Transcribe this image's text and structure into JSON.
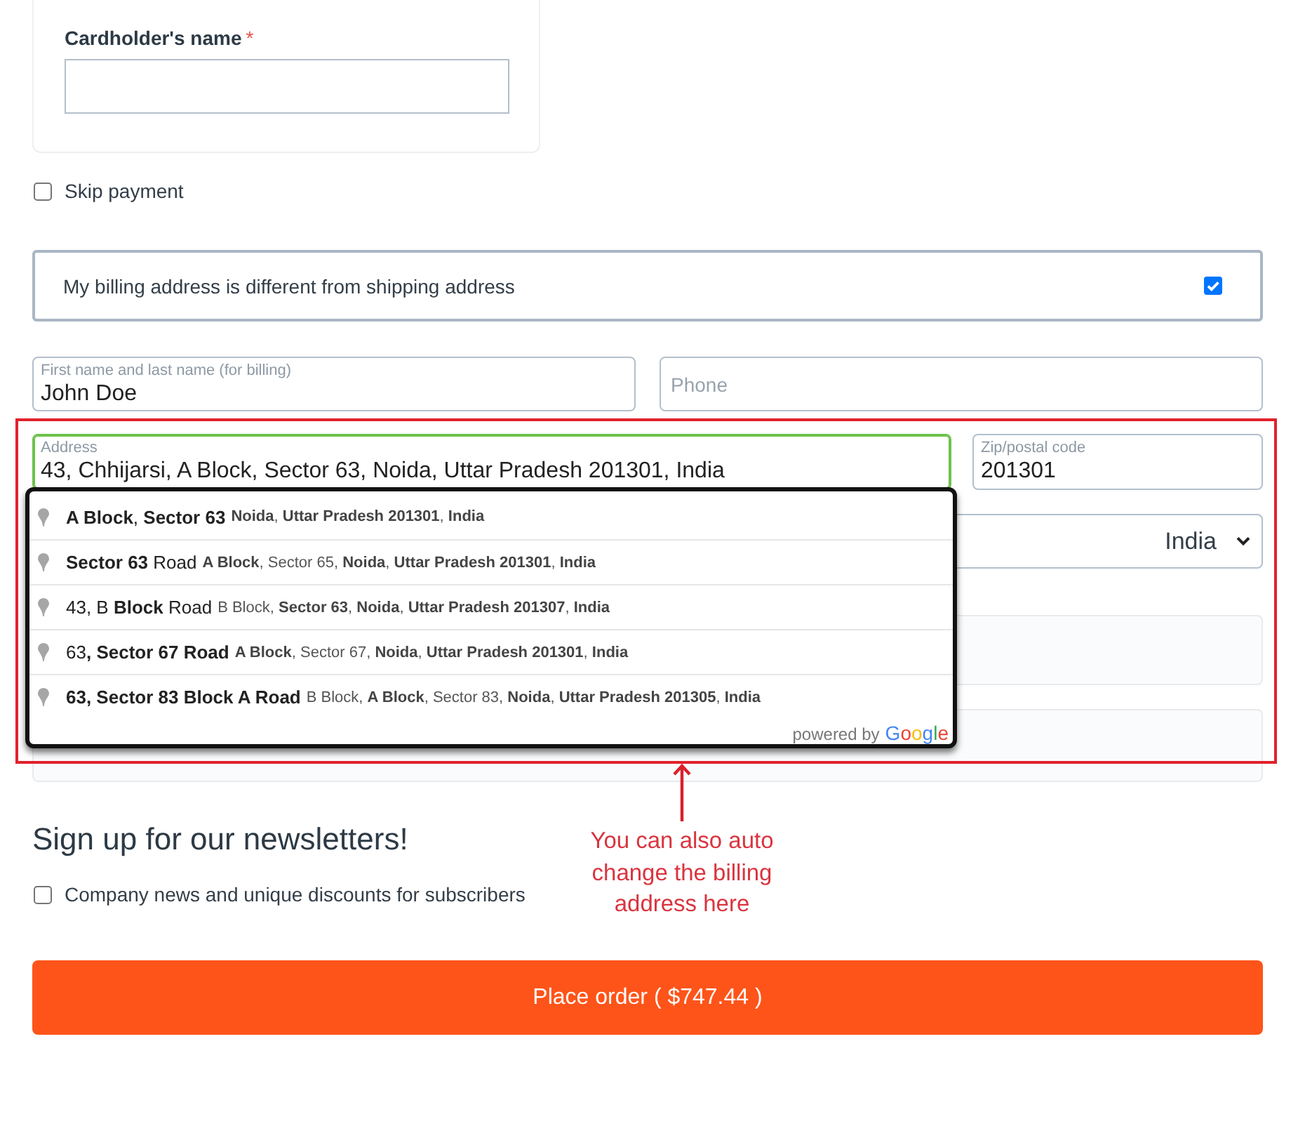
{
  "payment_card": {
    "label": "Cardholder's name",
    "required_mark": "*"
  },
  "skip_payment": {
    "label": "Skip payment",
    "checked": false
  },
  "billing_toggle": {
    "label": "My billing address is different from shipping address",
    "checked": true
  },
  "billing_fields": [
    {
      "kind": "text",
      "label": "First name and last name (for billing)",
      "value": "John Doe",
      "focused": false
    },
    {
      "kind": "text",
      "placeholder": "Phone",
      "focused": false
    },
    {
      "kind": "text",
      "label": "Address",
      "value": "43, Chhijarsi, A Block, Sector 63, Noida, Uttar Pradesh 201301, India",
      "focused": true
    },
    {
      "kind": "text",
      "label": "Zip/postal code",
      "value": "201301",
      "focused": false
    },
    {
      "kind": "select",
      "value": "India"
    }
  ],
  "autocomplete": {
    "suggestions": [
      {
        "main": "**A Block**, **Sector 63**",
        "secondary": "**Noida**, **Uttar Pradesh 201301**, **India**"
      },
      {
        "main": "**Sector 63** Road",
        "secondary": "**A Block**, Sector 65, **Noida**, **Uttar Pradesh 201301**, **India**"
      },
      {
        "main": "43, B **Block** Road",
        "secondary": "B Block, **Sector 63**, **Noida**, **Uttar Pradesh 201307**, **India**"
      },
      {
        "main": "63**, Sector 67 Road**",
        "secondary": "**A Block**, Sector 67, **Noida**, **Uttar Pradesh 201301**, **India**"
      },
      {
        "main": "**63, Sector 83 Block A Road**",
        "secondary": "B Block, **A Block**, Sector 83, **Noida**, **Uttar Pradesh 201305**, **India**"
      }
    ],
    "attribution": {
      "prefix": "powered by",
      "logo": "Google"
    }
  },
  "newsletter": {
    "title": "Sign up for our newsletters!",
    "options": [
      {
        "label": "Company news and unique discounts for subscribers",
        "checked": false
      }
    ]
  },
  "place_order": {
    "label": "Place order ( $747.44 )"
  },
  "annotation": {
    "text": "You can also auto change the billing address here"
  }
}
